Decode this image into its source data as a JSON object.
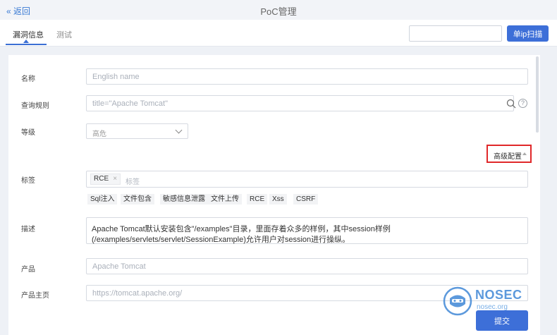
{
  "header": {
    "back_label": "« 返回",
    "title": "PoC管理"
  },
  "tabs": {
    "vuln_info": "漏洞信息",
    "test": "测试"
  },
  "toolbar": {
    "ip_input_value": "",
    "scan_label": "单ip扫描"
  },
  "form": {
    "name": {
      "label": "名称",
      "placeholder": "English name"
    },
    "query": {
      "label": "查询规则",
      "value": "title=\"Apache Tomcat\""
    },
    "level": {
      "label": "等级",
      "value": "高危"
    },
    "advanced": {
      "label": "高级配置"
    },
    "tags": {
      "label": "标签",
      "chip": "RCE",
      "placeholder": "标签",
      "quick": [
        "Sql注入",
        "文件包含",
        "敏感信息泄露",
        "文件上传",
        "RCE",
        "Xss",
        "CSRF"
      ]
    },
    "description": {
      "label": "描述",
      "line1": "Apache Tomcat默认安装包含\"/examples\"目录，里面存着众多的样例，其中session样例",
      "line2": "(/examples/servlets/servlet/SessionExample)允许用户对session进行操纵。"
    },
    "product": {
      "label": "产品",
      "value": "Apache Tomcat"
    },
    "homepage": {
      "label": "产品主页",
      "value": "https://tomcat.apache.org/"
    }
  },
  "submit_label": "提交",
  "watermark": {
    "brand": "NOSEC",
    "domain": "nosec.org"
  },
  "colors": {
    "primary": "#3d6fd8",
    "highlight": "#e0282a"
  }
}
